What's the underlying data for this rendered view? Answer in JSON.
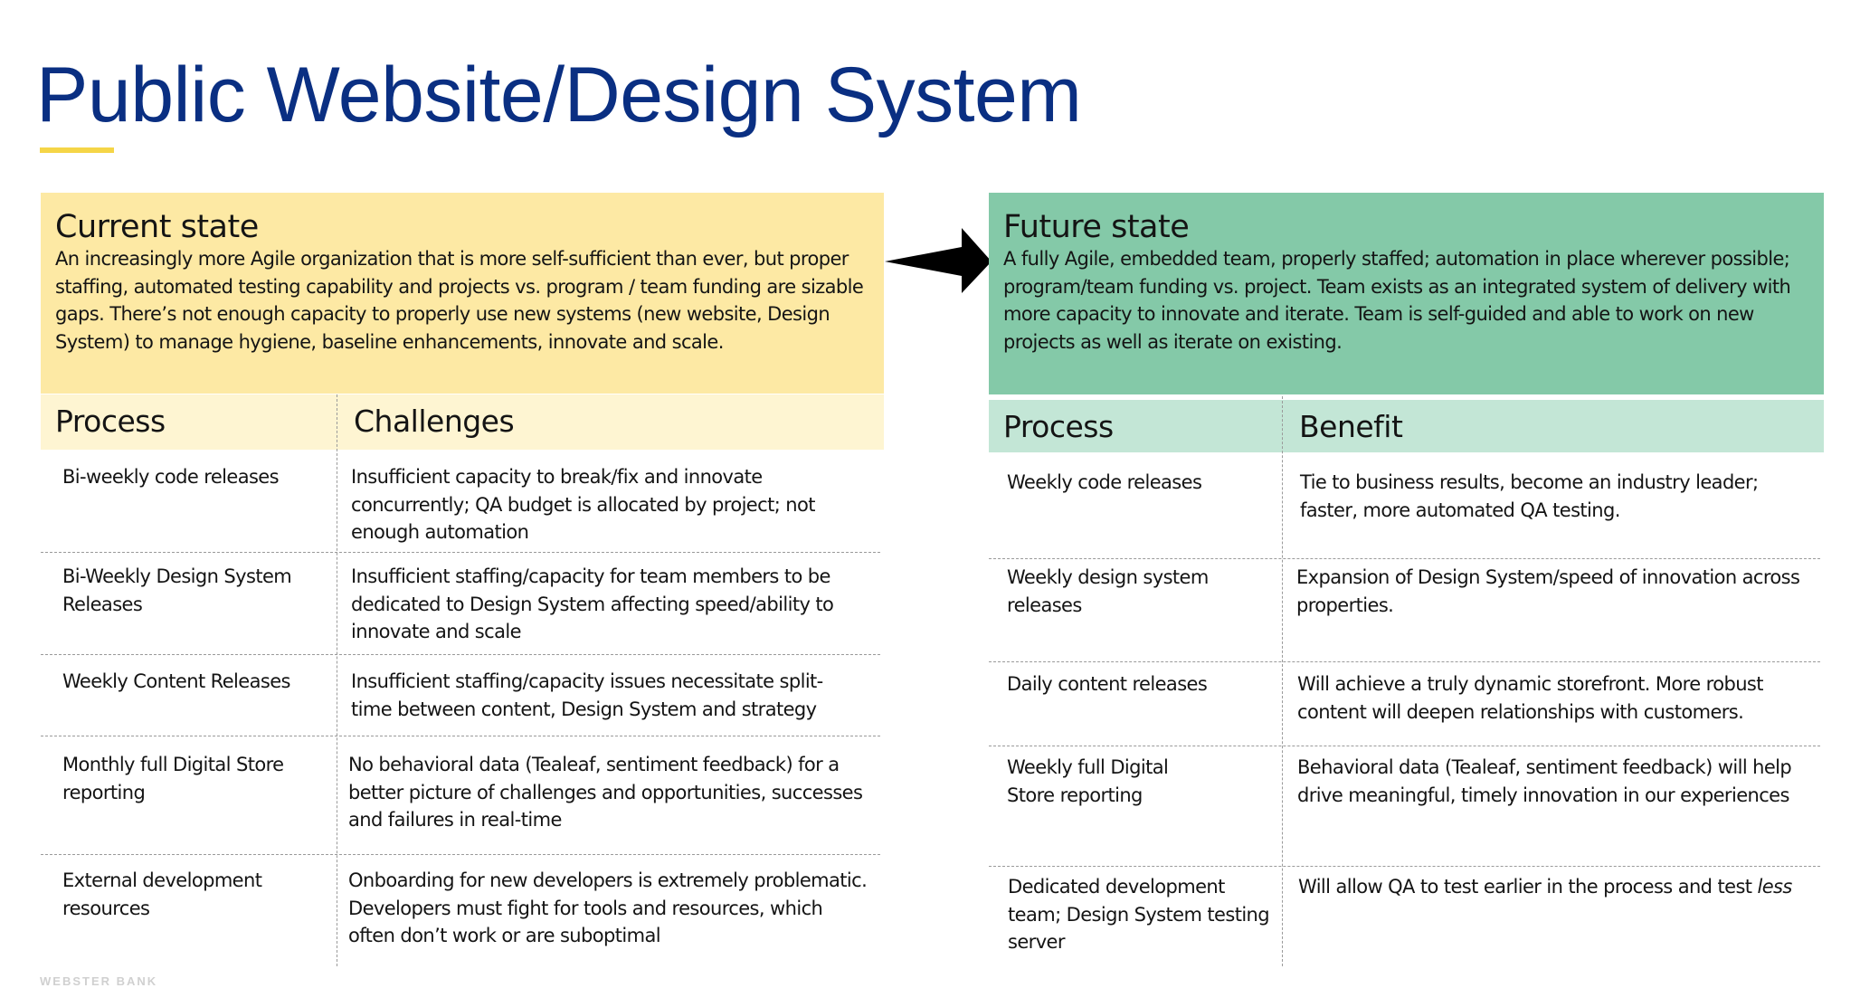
{
  "slide": {
    "title": "Public Website/Design System",
    "accent_color": "#f5d547",
    "title_color": "#0a2f82",
    "footer_mark": "WEBSTER BANK"
  },
  "current": {
    "title": "Current state",
    "description": "An increasingly more Agile organization that is more self-sufficient than ever, but proper staffing, automated testing capability and projects vs. program / team funding are sizable gaps. There’s not enough capacity to properly use new systems (new website, Design System) to manage hygiene, baseline enhancements, innovate and scale.",
    "color": "#fde9a4",
    "table_header_color": "#fef5d2",
    "columns": [
      "Process",
      "Challenges"
    ],
    "rows": [
      {
        "process": "Bi-weekly code releases",
        "detail": "Insufficient capacity to break/fix and innovate concurrently; QA budget is allocated by project; not enough automation"
      },
      {
        "process": "Bi-Weekly Design System Releases",
        "detail": "Insufficient staffing/capacity for team members to be dedicated to Design System affecting speed/ability to innovate and scale"
      },
      {
        "process": "Weekly Content Releases",
        "detail": "Insufficient staffing/capacity issues necessitate split-time between content, Design System and strategy"
      },
      {
        "process": "Monthly full Digital Store reporting",
        "detail": "No behavioral data (Tealeaf, sentiment feedback) for a better picture of challenges and opportunities, successes and failures in real-time"
      },
      {
        "process": "External development resources",
        "detail": "Onboarding for new developers is extremely problematic. Developers must fight for tools and resources, which often don’t work or are suboptimal"
      }
    ]
  },
  "transition_icon": "arrow-right-icon",
  "future": {
    "title": "Future state",
    "description": "A fully Agile, embedded team, properly staffed; automation in place wherever possible; program/team funding vs. project. Team exists as an integrated system of delivery with more capacity to innovate and iterate. Team is self-guided and able to work on new projects as well as iterate on existing.",
    "color": "#84c9a8",
    "table_header_color": "#c3e6d6",
    "columns": [
      "Process",
      "Benefit"
    ],
    "rows": [
      {
        "process": "Weekly code releases",
        "detail": "Tie to business results, become an industry leader; faster, more automated QA testing."
      },
      {
        "process": "Weekly design system releases",
        "detail": "Expansion of Design System/speed of innovation across properties."
      },
      {
        "process": "Daily content releases",
        "detail": "Will achieve a truly dynamic storefront. More robust content will deepen relationships with customers."
      },
      {
        "process": "Weekly full Digital Store reporting",
        "detail": "Behavioral data (Tealeaf, sentiment feedback) will help drive meaningful, timely innovation in our experiences"
      },
      {
        "process": "Dedicated development team; Design System testing server",
        "detail": "Will allow QA to test earlier in the process and test",
        "detail_emphasis": "less"
      }
    ]
  }
}
